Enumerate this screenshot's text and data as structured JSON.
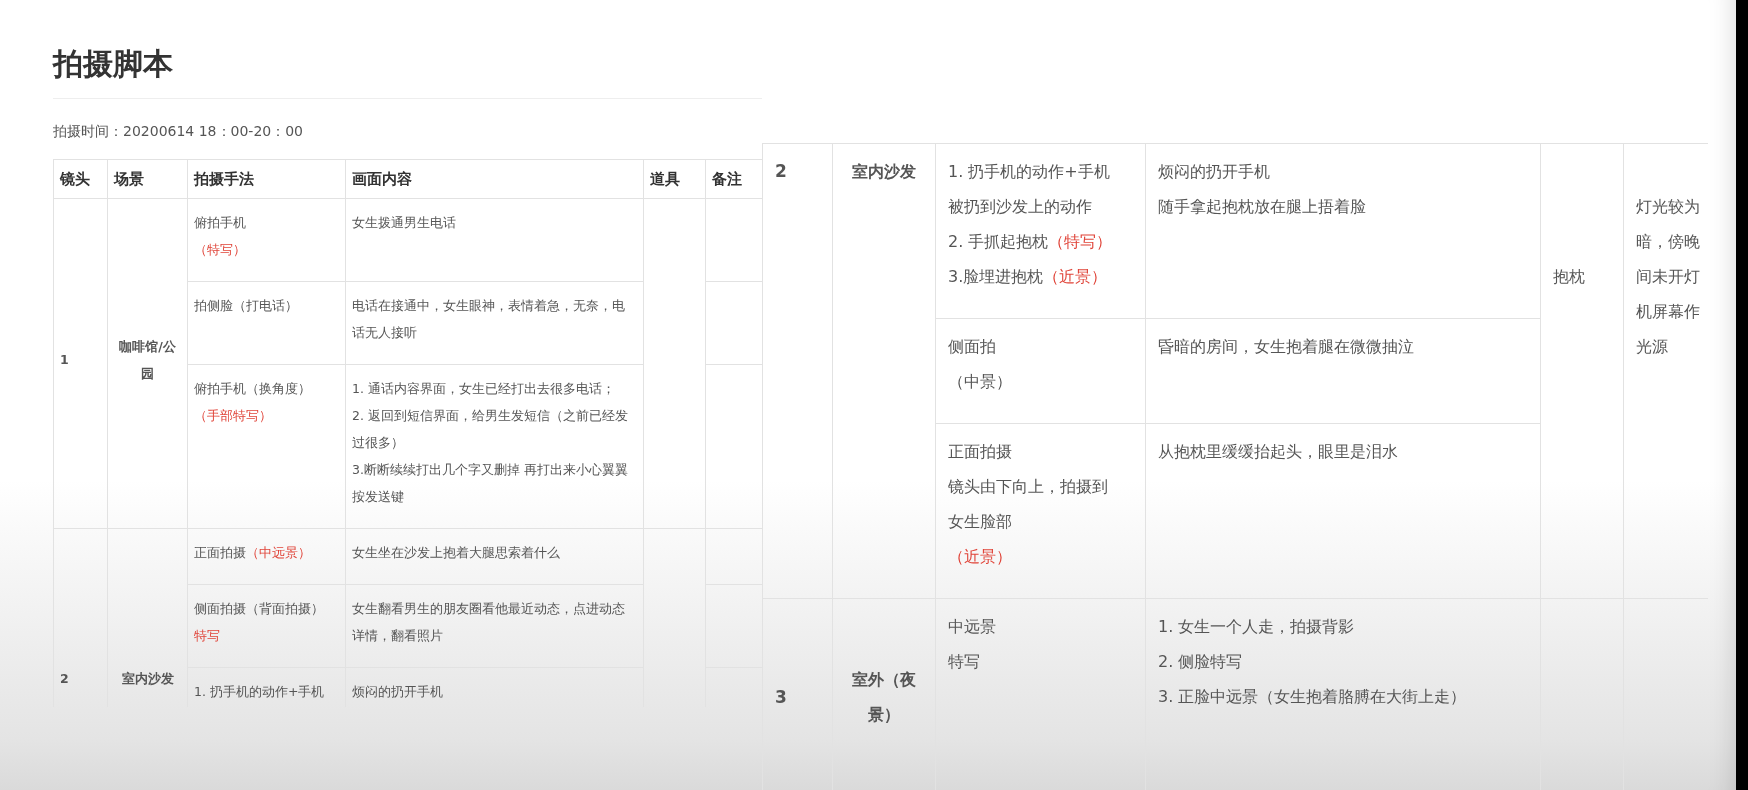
{
  "left_page": {
    "title": "拍摄脚本",
    "shoot_time": "拍摄时间：20200614 18：00-20：00",
    "table": {
      "columns": [
        "镜头",
        "场景",
        "拍摄手法",
        "画面内容",
        "道具",
        "备注"
      ],
      "rows": [
        {
          "shot": "1",
          "scene": "咖啡馆/公园",
          "subrows": [
            {
              "method": [
                [
                  {
                    "text": "俯拍手机",
                    "highlighted": false
                  }
                ],
                [
                  {
                    "text": "（特写）",
                    "highlighted": true
                  }
                ]
              ],
              "content": [
                "女生拨通男生电话"
              ]
            },
            {
              "method": [
                [
                  {
                    "text": "拍侧脸（打电话）",
                    "highlighted": false
                  }
                ]
              ],
              "content": [
                "电话在接通中，女生眼神，表情着急，无奈，电话无人接听"
              ]
            },
            {
              "method": [
                [
                  {
                    "text": "俯拍手机（换角度）",
                    "highlighted": false
                  }
                ],
                [
                  {
                    "text": "（手部特写）",
                    "highlighted": true
                  }
                ]
              ],
              "content": [
                "1. 通话内容界面，女生已经打出去很多电话；",
                "2. 返回到短信界面，给男生发短信（之前已经发过很多）",
                "3.断断续续打出几个字又删掉 再打出来小心翼翼按发送键"
              ]
            }
          ]
        },
        {
          "shot": "2",
          "scene": "室内沙发",
          "subrows": [
            {
              "method": [
                [
                  {
                    "text": "正面拍摄",
                    "highlighted": false
                  },
                  {
                    "text": "（中远景）",
                    "highlighted": true
                  }
                ]
              ],
              "content": [
                "女生坐在沙发上抱着大腿思索着什么"
              ]
            },
            {
              "method": [
                [
                  {
                    "text": "侧面拍摄（背面拍摄）",
                    "highlighted": false
                  }
                ],
                [
                  {
                    "text": "特写",
                    "highlighted": true
                  }
                ]
              ],
              "content": [
                "女生翻看男生的朋友圈看他最近动态，点进动态详情，翻看照片"
              ]
            },
            {
              "method": [
                [
                  {
                    "text": "1. 扔手机的动作+手机",
                    "highlighted": false
                  }
                ]
              ],
              "content": [
                "烦闷的扔开手机"
              ]
            }
          ]
        }
      ]
    }
  },
  "right_page": {
    "table": {
      "rows": [
        {
          "shot": "2",
          "scene": "室内沙发",
          "props": "抱枕",
          "notes": [
            "灯光较为",
            "暗，傍晚",
            "间未开灯",
            "机屏幕作",
            "光源"
          ],
          "subrows": [
            {
              "method": [
                [
                  {
                    "text": "1. 扔手机的动作+手机",
                    "highlighted": false
                  }
                ],
                [
                  {
                    "text": "被扔到沙发上的动作",
                    "highlighted": false
                  }
                ],
                [
                  {
                    "text": "2. 手抓起抱枕",
                    "highlighted": false
                  },
                  {
                    "text": "（特写）",
                    "highlighted": true
                  }
                ],
                [
                  {
                    "text": "3.脸埋进抱枕",
                    "highlighted": false
                  },
                  {
                    "text": "（近景）",
                    "highlighted": true
                  }
                ]
              ],
              "content": [
                "烦闷的扔开手机",
                "随手拿起抱枕放在腿上捂着脸"
              ]
            },
            {
              "method": [
                [
                  {
                    "text": "侧面拍",
                    "highlighted": false
                  }
                ],
                [
                  {
                    "text": "（中景）",
                    "highlighted": false
                  }
                ]
              ],
              "content": [
                "昏暗的房间，女生抱着腿在微微抽泣"
              ]
            },
            {
              "method": [
                [
                  {
                    "text": "正面拍摄",
                    "highlighted": false
                  }
                ],
                [
                  {
                    "text": "镜头由下向上，拍摄到",
                    "highlighted": false
                  }
                ],
                [
                  {
                    "text": "女生脸部",
                    "highlighted": false
                  }
                ],
                [
                  {
                    "text": "（近景）",
                    "highlighted": true
                  }
                ]
              ],
              "content": [
                "从抱枕里缓缓抬起头，眼里是泪水"
              ]
            }
          ]
        },
        {
          "shot": "3",
          "scene": "室外（夜景）",
          "subrows": [
            {
              "method": [
                [
                  {
                    "text": "中远景",
                    "highlighted": false
                  }
                ],
                [
                  {
                    "text": "特写",
                    "highlighted": false
                  }
                ]
              ],
              "content": [
                "1. 女生一个人走，拍摄背影",
                "2. 侧脸特写",
                "3. 正脸中远景（女生抱着胳膊在大街上走）"
              ]
            }
          ]
        }
      ]
    }
  }
}
